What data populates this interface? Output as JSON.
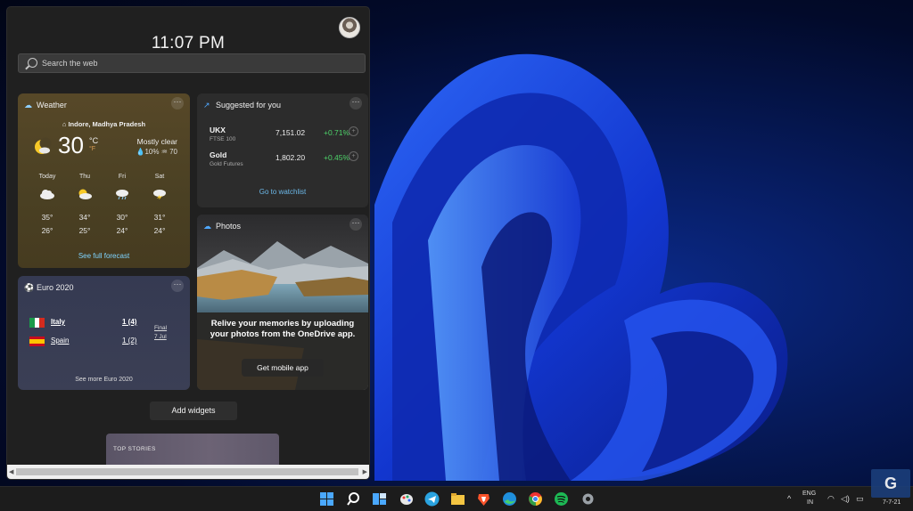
{
  "panel": {
    "time": "11:07 PM",
    "search_placeholder": "Search the web"
  },
  "weather": {
    "title": "Weather",
    "location": "Indore, Madhya Pradesh",
    "temp": "30",
    "unit_c": "°C",
    "unit_f": "°F",
    "condition": "Mostly clear",
    "precip": "10%",
    "aqi": "70",
    "days": [
      {
        "name": "Today",
        "hi": "35°",
        "lo": "26°",
        "icon": "cloud-icon"
      },
      {
        "name": "Thu",
        "hi": "34°",
        "lo": "25°",
        "icon": "partly-cloudy-icon"
      },
      {
        "name": "Fri",
        "hi": "30°",
        "lo": "24°",
        "icon": "rain-icon"
      },
      {
        "name": "Sat",
        "hi": "31°",
        "lo": "24°",
        "icon": "thunderstorm-icon"
      }
    ],
    "link": "See full forecast"
  },
  "suggested": {
    "title": "Suggested for you",
    "stocks": [
      {
        "name": "UKX",
        "sub": "FTSE 100",
        "value": "7,151.02",
        "change": "+0.71%"
      },
      {
        "name": "Gold",
        "sub": "Gold Futures",
        "value": "1,802.20",
        "change": "+0.45%"
      }
    ],
    "link": "Go to watchlist"
  },
  "photos": {
    "title": "Photos",
    "message": "Relive your memories by uploading your photos from the OneDrive app.",
    "button": "Get mobile app"
  },
  "euro": {
    "title": "Euro 2020",
    "teams": [
      {
        "name": "Italy",
        "score": "1 (4)"
      },
      {
        "name": "Spain",
        "score": "1 (2)"
      }
    ],
    "final_label": "Final",
    "final_date": "7 Jul",
    "link": "See more Euro 2020"
  },
  "add_widgets": "Add widgets",
  "top_stories": "TOP STORIES",
  "tray": {
    "lang": "ENG",
    "region": "IN",
    "date": "7-7-21"
  },
  "colors": {
    "accent_link": "#7fd4ff",
    "gain": "#4ed46a",
    "taskbar": "#1c1c1c"
  }
}
